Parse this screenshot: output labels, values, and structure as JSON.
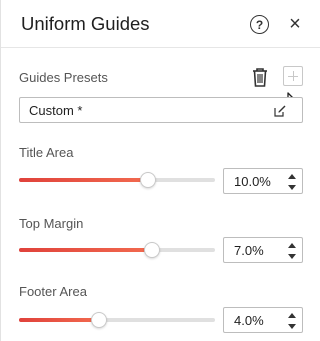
{
  "panel": {
    "title": "Uniform Guides",
    "help_icon": "question-circle-icon",
    "close_icon": "close-icon"
  },
  "presets": {
    "label": "Guides Presets",
    "selected": "Custom *",
    "trash_icon": "trash-icon",
    "add_icon": "plus-icon",
    "edit_icon": "edit-icon"
  },
  "settings": [
    {
      "label": "Title Area",
      "value": "10.0%",
      "level": 0.66
    },
    {
      "label": "Top Margin",
      "value": "7.0%",
      "level": 0.68
    },
    {
      "label": "Footer Area",
      "value": "4.0%",
      "level": 0.41
    }
  ],
  "colors": {
    "accent": "#e0423b",
    "track": "#e0e0e0"
  }
}
